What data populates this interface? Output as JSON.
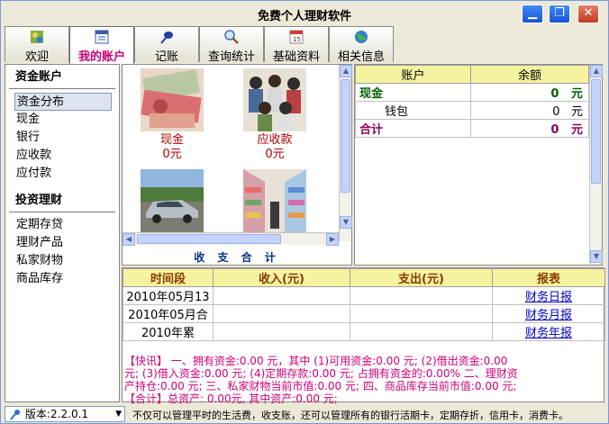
{
  "window": {
    "title": "免费个人理财软件",
    "minimize_glyph": "▁",
    "restore_glyph": "❐",
    "close_glyph": "✕"
  },
  "tabs": [
    {
      "label": "欢迎",
      "icon": "welcome-icon"
    },
    {
      "label": "我的账户",
      "icon": "account-icon",
      "active": true
    },
    {
      "label": "记账",
      "icon": "pen-icon"
    },
    {
      "label": "查询统计",
      "icon": "magnifier-icon"
    },
    {
      "label": "基础资料",
      "icon": "calendar-icon"
    },
    {
      "label": "相关信息",
      "icon": "globe-icon"
    }
  ],
  "sidebar": {
    "section1_title": "资金账户",
    "section1_items": [
      "资金分布",
      "现金",
      "银行",
      "应收款",
      "应付款"
    ],
    "section2_title": "投资理财",
    "section2_items": [
      "定期存贷",
      "理财产品",
      "私家财物",
      "商品库存"
    ]
  },
  "tiles": [
    {
      "name": "现金",
      "value": "0元",
      "image": "cash-photo"
    },
    {
      "name": "应收款",
      "value": "0元",
      "image": "crowd-photo"
    },
    {
      "name": "",
      "value": "",
      "image": "car-photo"
    },
    {
      "name": "",
      "value": "",
      "image": "store-shelves-photo"
    }
  ],
  "income_caption": "收 支 合 计",
  "accounts": {
    "headers": [
      "账户",
      "余额"
    ],
    "rows": [
      {
        "name": "现金",
        "amount": "0",
        "unit": "元",
        "bold": true
      },
      {
        "name": "钱包",
        "amount": "0",
        "unit": "元",
        "bold": false
      },
      {
        "name": "合计",
        "amount": "0",
        "unit": "元",
        "bold": true
      }
    ]
  },
  "summary": {
    "headers": [
      "时间段",
      "收入(元)",
      "支出(元)",
      "报表"
    ],
    "rows": [
      {
        "period": "2010年05月13",
        "income": "",
        "expense": "",
        "report": "财务日报"
      },
      {
        "period": "2010年05月合",
        "income": "",
        "expense": "",
        "report": "财务月报"
      },
      {
        "period": "2010年累",
        "income": "",
        "expense": "",
        "report": "财务年报"
      }
    ],
    "news_line1": "【快讯】 一、拥有资金:0.00 元，其中 (1)可用资金:0.00 元; (2)借出资金:0.00",
    "news_line2": "元; (3)借入资金:0.00 元; (4)定期存款:0.00 元; 占拥有资金的:0.00%  二、理财资",
    "news_line3": "产持仓:0.00 元;  三、私家财物当前市值:0.00 元;  四、商品库存当前市值:0.00 元;",
    "news_line4": "【合计】总资产: 0.00元,  其中资产:0.00 元;"
  },
  "status": {
    "version_label": "版本:2.2.0.1",
    "text": "不仅可以管理平时的生活费，收支账，还可以管理所有的银行活期卡，定期存折，信用卡，消费卡。"
  }
}
